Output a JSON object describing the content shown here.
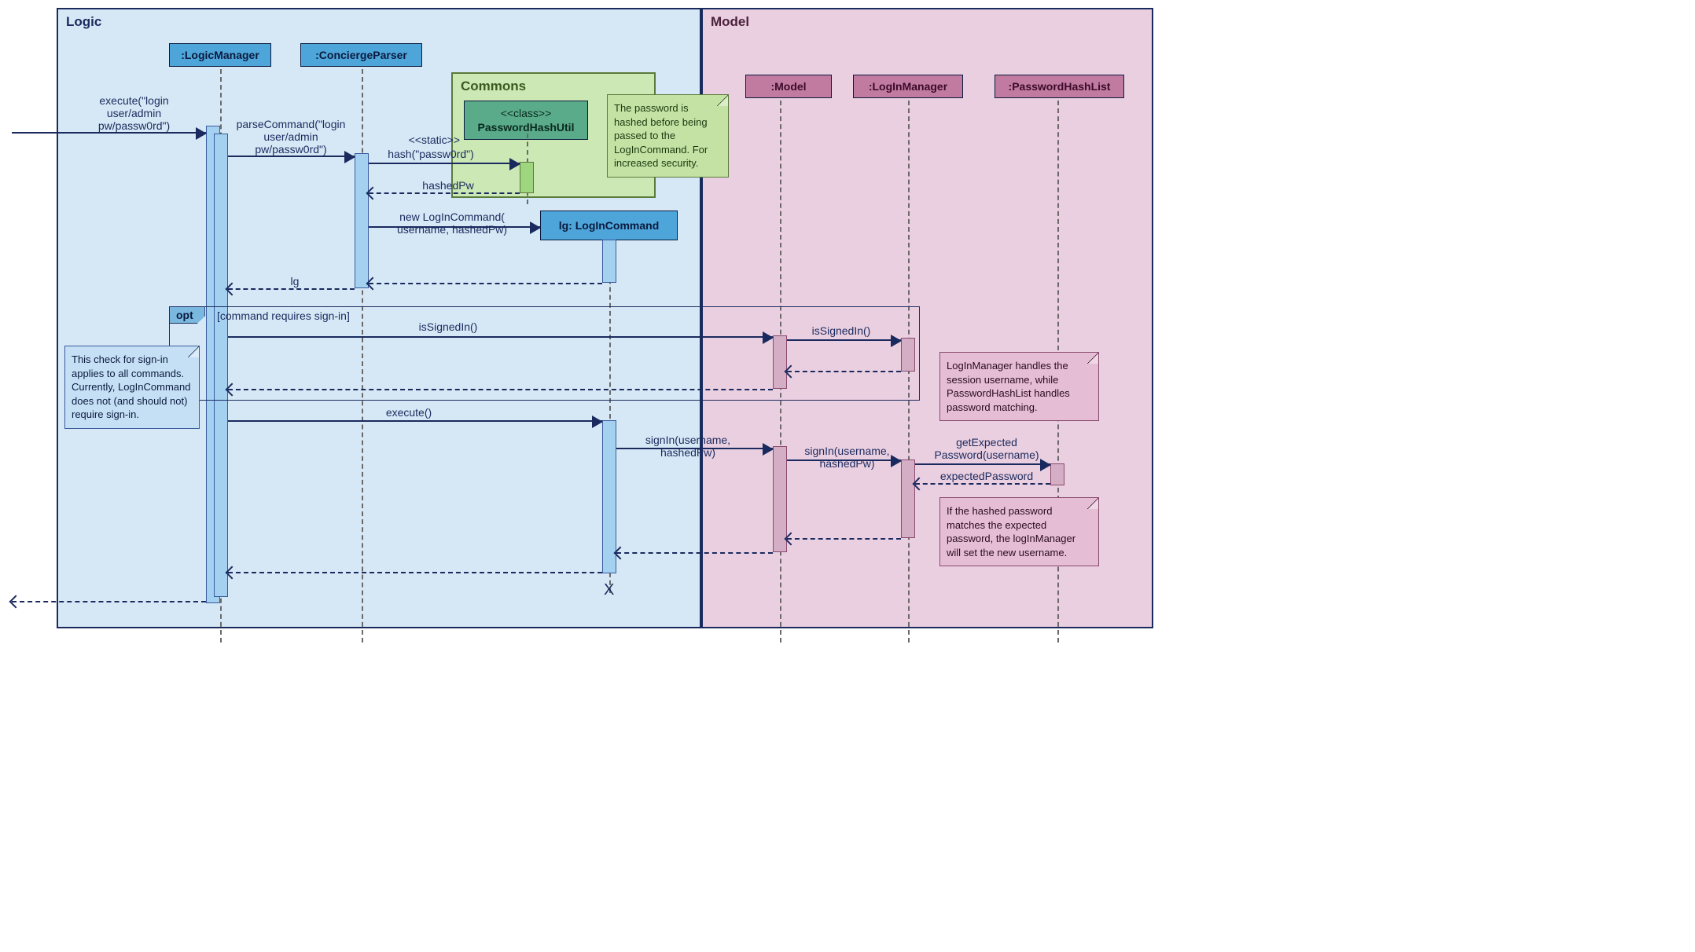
{
  "containers": {
    "logic": "Logic",
    "model": "Model",
    "commons": "Commons"
  },
  "lifelines": {
    "logic_manager": ":LogicManager",
    "concierge_parser": ":ConciergeParser",
    "password_hash_util_stereotype": "<<class>>",
    "password_hash_util": "PasswordHashUtil",
    "login_command": "lg: LogInCommand",
    "model": ":Model",
    "login_manager": ":LogInManager",
    "password_hash_list": ":PasswordHashList"
  },
  "messages": {
    "execute_login": "execute(\"login\nuser/admin\npw/passw0rd\")",
    "parse_command": "parseCommand(\"login\nuser/admin\npw/passw0rd\")",
    "static": "<<static>>",
    "hash": "hash(\"passw0rd\")",
    "hashed_pw": "hashedPw",
    "new_login_command": "new LogInCommand(\nusername, hashedPw)",
    "lg_return": "lg",
    "is_signed_in_1": "isSignedIn()",
    "is_signed_in_2": "isSignedIn()",
    "execute": "execute()",
    "signin_1": "signIn(username,\nhashedPw)",
    "signin_2": "signIn(username,\nhashedPw)",
    "get_expected_password": "getExpected\nPassword(username)",
    "expected_password": "expectedPassword"
  },
  "fragment": {
    "opt_label": "opt",
    "opt_guard": "[command requires sign-in]"
  },
  "notes": {
    "hash_note": "The password is hashed before being passed to the LogInCommand. For increased security.",
    "signin_check_note": "This check for sign-in applies to all commands. Currently, LogInCommand does not (and should not) require sign-in.",
    "login_manager_note": "LogInManager handles the session username, while PasswordHashList handles password matching.",
    "password_match_note": "If the hashed password matches the expected password, the logInManager will set the new username."
  },
  "destroy": "X"
}
